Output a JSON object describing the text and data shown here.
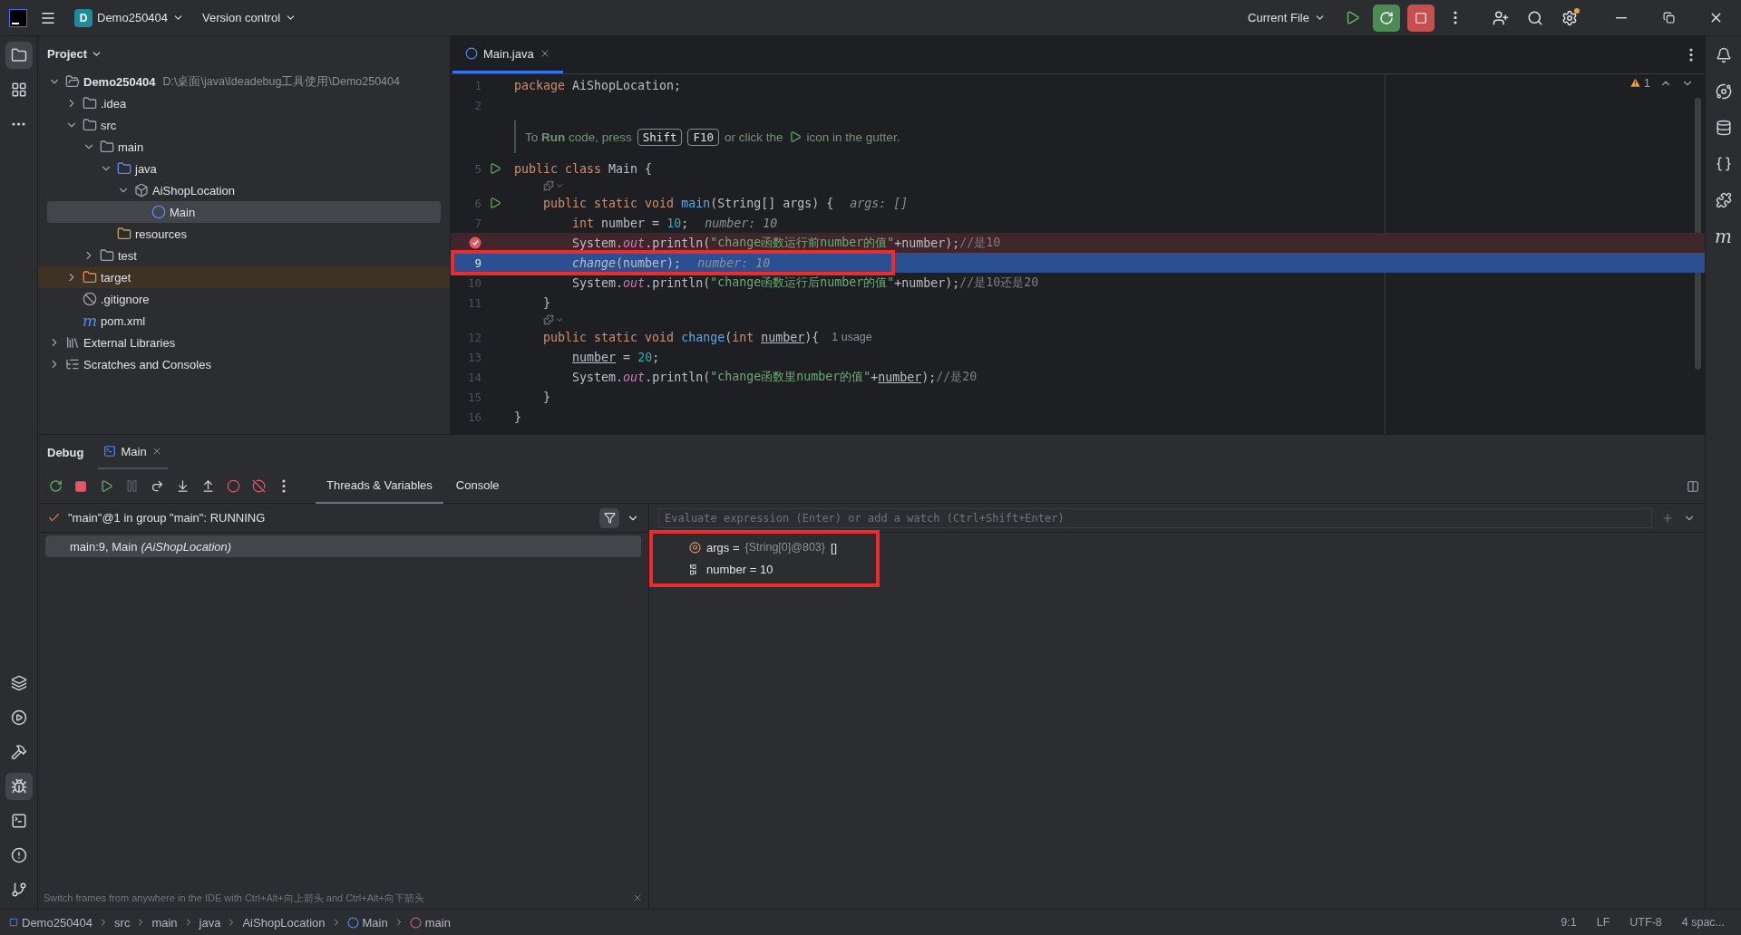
{
  "titlebar": {
    "project_badge": "D",
    "project": "Demo250404",
    "vcs": "Version control",
    "run_config": "Current File"
  },
  "left_tools": [
    {
      "kind": "project",
      "selected": true
    },
    {
      "kind": "structure",
      "selected": false
    },
    {
      "kind": "more",
      "selected": false
    }
  ],
  "left_tools_bottom": [
    {
      "kind": "layers",
      "selected": false
    },
    {
      "kind": "services",
      "selected": false
    },
    {
      "kind": "build",
      "selected": false
    },
    {
      "kind": "debug",
      "selected": true
    },
    {
      "kind": "terminal",
      "selected": false
    },
    {
      "kind": "problems",
      "selected": false
    },
    {
      "kind": "git",
      "selected": false
    }
  ],
  "project_panel": {
    "title": "Project",
    "tree": [
      {
        "label": "Demo250404",
        "path": "D:\\桌面\\java\\Ideadebug工具使用\\Demo250404",
        "kind": "module",
        "expanded": true,
        "selected": false,
        "children": [
          {
            "label": ".idea",
            "kind": "folder",
            "expanded": false,
            "selected": false
          },
          {
            "label": "src",
            "kind": "folder",
            "expanded": true,
            "selected": false,
            "children": [
              {
                "label": "main",
                "kind": "folder",
                "expanded": true,
                "selected": false,
                "children": [
                  {
                    "label": "java",
                    "kind": "source",
                    "expanded": true,
                    "selected": false,
                    "children": [
                      {
                        "label": "AiShopLocation",
                        "kind": "package",
                        "expanded": true,
                        "selected": false,
                        "children": [
                          {
                            "label": "Main",
                            "kind": "class",
                            "selected": true
                          }
                        ]
                      }
                    ]
                  },
                  {
                    "label": "resources",
                    "kind": "resources",
                    "selected": false
                  }
                ]
              },
              {
                "label": "test",
                "kind": "folder",
                "expanded": false,
                "selected": false
              }
            ]
          },
          {
            "label": "target",
            "kind": "excluded",
            "expanded": false,
            "selected": false
          },
          {
            "label": ".gitignore",
            "kind": "ignore",
            "selected": false
          },
          {
            "label": "pom.xml",
            "kind": "maven",
            "glyph": "m",
            "selected": false
          }
        ]
      },
      {
        "label": "External Libraries",
        "kind": "libraries",
        "expanded": false,
        "selected": false
      },
      {
        "label": "Scratches and Consoles",
        "kind": "scratches",
        "expanded": false,
        "selected": false
      }
    ]
  },
  "editor": {
    "tab": {
      "label": "Main.java",
      "selected": true
    },
    "warnings": "1",
    "lines": [
      {
        "kind": "code",
        "number": "1",
        "run": false,
        "breakpoint": false,
        "current": false,
        "tokens": [
          {
            "kind": "kw",
            "text": "package "
          },
          {
            "kind": "plain",
            "text": "AiShopLocation;"
          }
        ]
      },
      {
        "kind": "code",
        "number": "2",
        "run": false,
        "breakpoint": false,
        "current": false
      },
      {
        "kind": "hint",
        "parts": [
          {
            "kind": "text",
            "text": "To **Run** code, press"
          },
          {
            "kind": "key",
            "text": "Shift"
          },
          {
            "kind": "key",
            "text": "F10"
          },
          {
            "kind": "text",
            "text": "or click the"
          },
          {
            "kind": "run-icon"
          },
          {
            "kind": "text",
            "text": "icon in the gutter."
          }
        ]
      },
      {
        "kind": "code",
        "number": "5",
        "run": true,
        "breakpoint": false,
        "current": false,
        "tokens": [
          {
            "kind": "kw",
            "text": "public class "
          },
          {
            "kind": "plain",
            "text": "Main {"
          }
        ]
      },
      {
        "kind": "lens"
      },
      {
        "kind": "code",
        "number": "6",
        "run": true,
        "breakpoint": false,
        "current": false,
        "tokens": [
          {
            "kind": "kw",
            "text": "    public static void "
          },
          {
            "kind": "fn",
            "text": "main"
          },
          {
            "kind": "plain",
            "text": "(String[] args) {"
          },
          {
            "kind": "inlay",
            "text": "args: []"
          }
        ]
      },
      {
        "kind": "code",
        "number": "7",
        "run": false,
        "breakpoint": false,
        "current": false,
        "tokens": [
          {
            "kind": "kw",
            "text": "        int "
          },
          {
            "kind": "plain",
            "text": "number = "
          },
          {
            "kind": "num",
            "text": "10"
          },
          {
            "kind": "plain",
            "text": ";"
          },
          {
            "kind": "inlay",
            "text": "number: 10"
          }
        ]
      },
      {
        "kind": "code",
        "run": false,
        "breakpoint": true,
        "current": false,
        "tokens": [
          {
            "kind": "plain",
            "text": "        System."
          },
          {
            "kind": "field",
            "text": "out"
          },
          {
            "kind": "plain",
            "text": ".println("
          },
          {
            "kind": "str",
            "text": "\"change函数运行前number的值\""
          },
          {
            "kind": "plain",
            "text": "+number);"
          },
          {
            "kind": "comment",
            "text": "//是10"
          }
        ]
      },
      {
        "kind": "code",
        "number": "9",
        "run": false,
        "breakpoint": false,
        "current": true,
        "annotated": true,
        "tokens": [
          {
            "kind": "call",
            "text": "        change"
          },
          {
            "kind": "plain",
            "text": "(number);"
          },
          {
            "kind": "inlay",
            "text": "number: 10"
          }
        ]
      },
      {
        "kind": "code",
        "number": "10",
        "run": false,
        "breakpoint": false,
        "current": false,
        "tokens": [
          {
            "kind": "plain",
            "text": "        System."
          },
          {
            "kind": "field",
            "text": "out"
          },
          {
            "kind": "plain",
            "text": ".println("
          },
          {
            "kind": "str",
            "text": "\"change函数运行后number的值\""
          },
          {
            "kind": "plain",
            "text": "+number);"
          },
          {
            "kind": "comment",
            "text": "//是10还是20"
          }
        ]
      },
      {
        "kind": "code",
        "number": "11",
        "run": false,
        "breakpoint": false,
        "current": false,
        "tokens": [
          {
            "kind": "plain",
            "text": "    }"
          }
        ]
      },
      {
        "kind": "lens"
      },
      {
        "kind": "code",
        "number": "12",
        "run": false,
        "breakpoint": false,
        "current": false,
        "tokens": [
          {
            "kind": "kw",
            "text": "    public static void "
          },
          {
            "kind": "fn",
            "text": "change"
          },
          {
            "kind": "plain",
            "text": "("
          },
          {
            "kind": "kw",
            "text": "int "
          },
          {
            "kind": "param",
            "text": "number"
          },
          {
            "kind": "plain",
            "text": "){"
          },
          {
            "kind": "usage",
            "text": "1 usage"
          }
        ]
      },
      {
        "kind": "code",
        "number": "13",
        "run": false,
        "breakpoint": false,
        "current": false,
        "tokens": [
          {
            "kind": "param",
            "text": "        number"
          },
          {
            "kind": "plain",
            "text": " = "
          },
          {
            "kind": "num",
            "text": "20"
          },
          {
            "kind": "plain",
            "text": ";"
          }
        ]
      },
      {
        "kind": "code",
        "number": "14",
        "run": false,
        "breakpoint": false,
        "current": false,
        "tokens": [
          {
            "kind": "plain",
            "text": "        System."
          },
          {
            "kind": "field",
            "text": "out"
          },
          {
            "kind": "plain",
            "text": ".println("
          },
          {
            "kind": "str",
            "text": "\"change函数里number的值\""
          },
          {
            "kind": "plain",
            "text": "+"
          },
          {
            "kind": "param",
            "text": "number"
          },
          {
            "kind": "plain",
            "text": ");"
          },
          {
            "kind": "comment",
            "text": "//是20"
          }
        ]
      },
      {
        "kind": "code",
        "number": "15",
        "run": false,
        "breakpoint": false,
        "current": false,
        "tokens": [
          {
            "kind": "plain",
            "text": "    }"
          }
        ]
      },
      {
        "kind": "code",
        "number": "16",
        "run": false,
        "breakpoint": false,
        "current": false,
        "tokens": [
          {
            "kind": "plain",
            "text": "}"
          }
        ]
      }
    ]
  },
  "right_tools": [
    {
      "kind": "notifications"
    },
    {
      "kind": "ai"
    },
    {
      "kind": "database"
    },
    {
      "kind": "python"
    },
    {
      "kind": "plugin"
    },
    {
      "kind": "maven",
      "glyph": "m"
    }
  ],
  "debug": {
    "title": "Debug",
    "session_tab": "Main",
    "toolbar": [
      {
        "kind": "rerun",
        "disabled": false
      },
      {
        "kind": "stop",
        "disabled": false
      },
      {
        "kind": "resume",
        "disabled": false
      },
      {
        "kind": "pause",
        "disabled": true
      },
      {
        "kind": "step-over",
        "disabled": false
      },
      {
        "kind": "step-into",
        "disabled": false
      },
      {
        "kind": "step-out",
        "disabled": false
      },
      {
        "kind": "breakpoints",
        "disabled": false
      },
      {
        "kind": "mute",
        "disabled": false
      },
      {
        "kind": "more",
        "disabled": false
      }
    ],
    "tabs": [
      {
        "label": "Threads & Variables",
        "selected": true
      },
      {
        "label": "Console",
        "selected": false
      }
    ],
    "thread": "\"main\"@1 in group \"main\": RUNNING",
    "frames": [
      {
        "text": "main:9, Main",
        "detail": "(AiShopLocation)",
        "selected": true
      }
    ],
    "evaluate_placeholder": "Evaluate expression (Enter) or add a watch (Ctrl+Shift+Enter)",
    "variables_annotated": true,
    "variables": [
      {
        "kind": "object",
        "name": "args",
        "operator": "=",
        "value": "{String[0]@803}",
        "extra": "[]"
      },
      {
        "kind": "primitive",
        "name": "number",
        "operator": "=",
        "value": "10"
      }
    ],
    "tip": "Switch frames from anywhere in the IDE with Ctrl+Alt+向上箭头 and Ctrl+Alt+向下箭头"
  },
  "status_bar": {
    "breadcrumbs": [
      {
        "kind": "module",
        "label": "Demo250404"
      },
      {
        "kind": "folder",
        "label": "src"
      },
      {
        "kind": "folder",
        "label": "main"
      },
      {
        "kind": "folder",
        "label": "java"
      },
      {
        "kind": "folder",
        "label": "AiShopLocation"
      },
      {
        "kind": "class",
        "label": "Main"
      },
      {
        "kind": "method",
        "label": "main"
      }
    ],
    "items": [
      "9:1",
      "LF",
      "UTF-8",
      "4 spac..."
    ]
  }
}
